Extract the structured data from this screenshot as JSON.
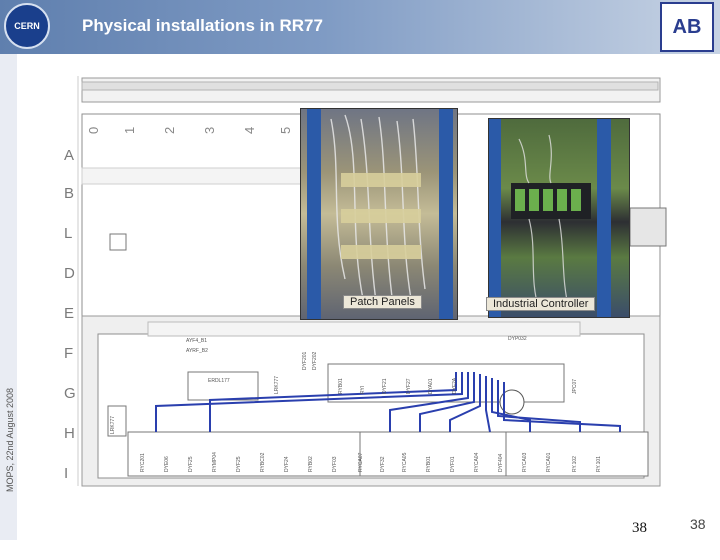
{
  "header": {
    "title": "Physical installations in RR77",
    "left_logo_text": "CERN",
    "right_logo_text": "AB"
  },
  "sidebar": {
    "footer_text": "MOPS, 22nd August 2008"
  },
  "floorplan": {
    "column_labels": [
      "0",
      "1",
      "2",
      "3",
      "4",
      "5"
    ],
    "row_labels": [
      "A",
      "B",
      "L",
      "D",
      "E",
      "F",
      "G",
      "H",
      "I"
    ],
    "rack_labels_upper": [
      "AYF4_B1",
      "AYRF_B2",
      "DYF201",
      "DYF202",
      "DYP032",
      "ERDL177",
      "LRK777",
      "RYB01",
      "RYI",
      "DYF21",
      "DYF27",
      "DYA01",
      "DYF2A"
    ],
    "rack_labels_lower": [
      "RYC201",
      "DYE06",
      "DYF25",
      "RYMP04",
      "DYF25",
      "RYBC02",
      "DYF24",
      "RYB02",
      "DYF03",
      "RYCA07",
      "DYF32",
      "RYCA05",
      "RYB01",
      "DYF01",
      "RYCA04",
      "DYF404",
      "RYCA03",
      "RYCA01",
      "RY.102",
      "RY.101"
    ],
    "wall_label": "LRK777",
    "right_label": "JPC07",
    "accent_color": "#2a3fae"
  },
  "photos": {
    "patch_caption": "Patch Panels",
    "controller_caption": "Industrial Controller"
  },
  "page": {
    "number_primary": "38",
    "number_secondary": "38"
  }
}
